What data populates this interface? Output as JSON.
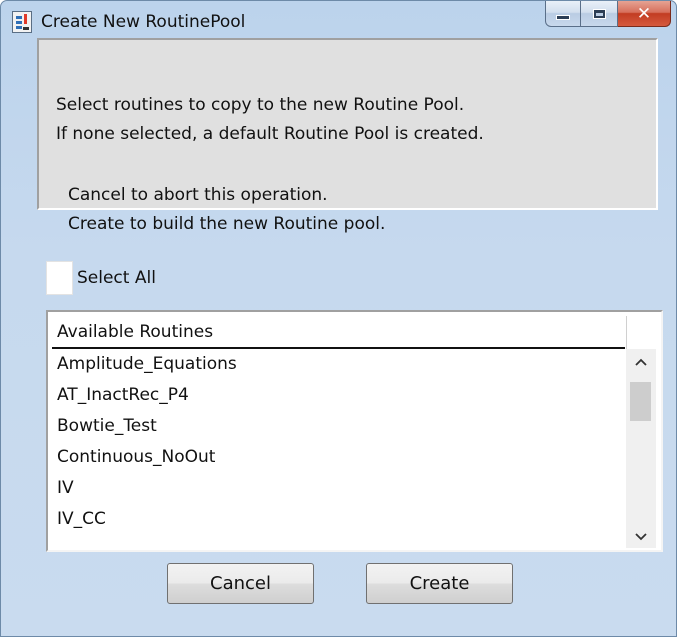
{
  "window": {
    "title": "Create New RoutinePool",
    "close_glyph": "✕"
  },
  "message": {
    "lines": [
      "Select routines to copy to the new Routine Pool.",
      "If none selected, a default Routine Pool is created.",
      "Cancel to abort this operation.",
      "Create to build the new Routine pool."
    ]
  },
  "select_all": {
    "label": "Select All",
    "checked": false
  },
  "list": {
    "header": "Available Routines",
    "items": [
      "Amplitude_Equations",
      "AT_InactRec_P4",
      "Bowtie_Test",
      "Continuous_NoOut",
      "IV",
      "IV_CC"
    ],
    "scroll_up_glyph": "^",
    "scroll_down_glyph": "v"
  },
  "buttons": {
    "cancel": "Cancel",
    "create": "Create"
  },
  "icons": {
    "app": "app-window-icon",
    "minimize": "minimize-icon",
    "maximize": "maximize-icon",
    "close": "close-icon"
  }
}
